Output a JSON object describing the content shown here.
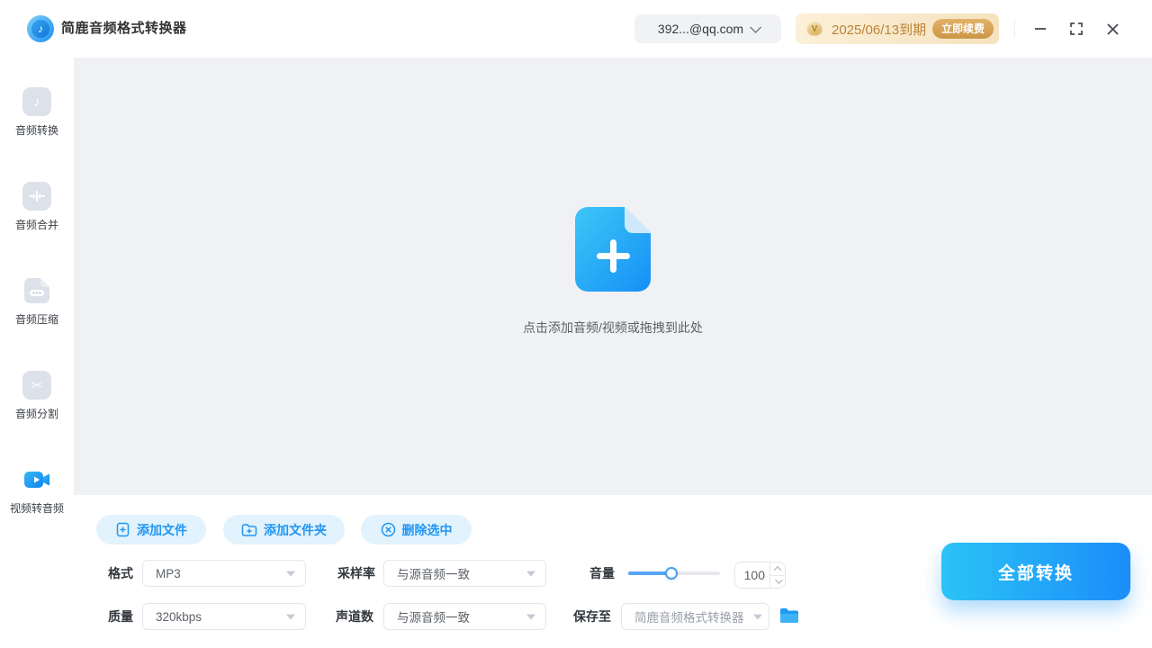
{
  "app": {
    "title": "简鹿音频格式转换器",
    "account": "392...@qq.com",
    "vip": {
      "expiry": "2025/06/13到期",
      "renew_label": "立即续费"
    }
  },
  "sidebar": {
    "items": [
      {
        "label": "音频转换",
        "icon": "music-note-icon",
        "active": false
      },
      {
        "label": "音频合并",
        "icon": "merge-icon",
        "active": false
      },
      {
        "label": "音频压缩",
        "icon": "compress-file-icon",
        "active": false
      },
      {
        "label": "音频分割",
        "icon": "scissors-icon",
        "active": false
      },
      {
        "label": "视频转音频",
        "icon": "video-camera-icon",
        "active": true
      }
    ]
  },
  "dropzone": {
    "hint": "点击添加音频/视频或拖拽到此处",
    "icon": "add-file-plus-icon"
  },
  "toolbar": {
    "add_file": "添加文件",
    "add_folder": "添加文件夹",
    "delete_selected": "删除选中"
  },
  "settings": {
    "format_label": "格式",
    "format_value": "MP3",
    "sample_rate_label": "采样率",
    "sample_rate_value": "与源音频一致",
    "volume_label": "音量",
    "volume_value": "100",
    "quality_label": "质量",
    "quality_value": "320kbps",
    "channels_label": "声道数",
    "channels_value": "与源音频一致",
    "save_to_label": "保存至",
    "save_to_value": "简鹿音频格式转换器"
  },
  "actions": {
    "convert_all": "全部转换"
  },
  "colors": {
    "accent": "#2196f3",
    "convert_gradient": [
      "#2bc3f6",
      "#1b8df9"
    ],
    "pill_button_bg": "#e2f3fd",
    "vip_banner_bg": [
      "#fcf0d8",
      "#f5e2bf"
    ],
    "vip_text": "#bb8336",
    "renew_button_bg": [
      "#e2b168",
      "#cb9646"
    ],
    "main_area_bg": "#f0f1f4",
    "inactive_icon_bg": "#dde1e9"
  }
}
